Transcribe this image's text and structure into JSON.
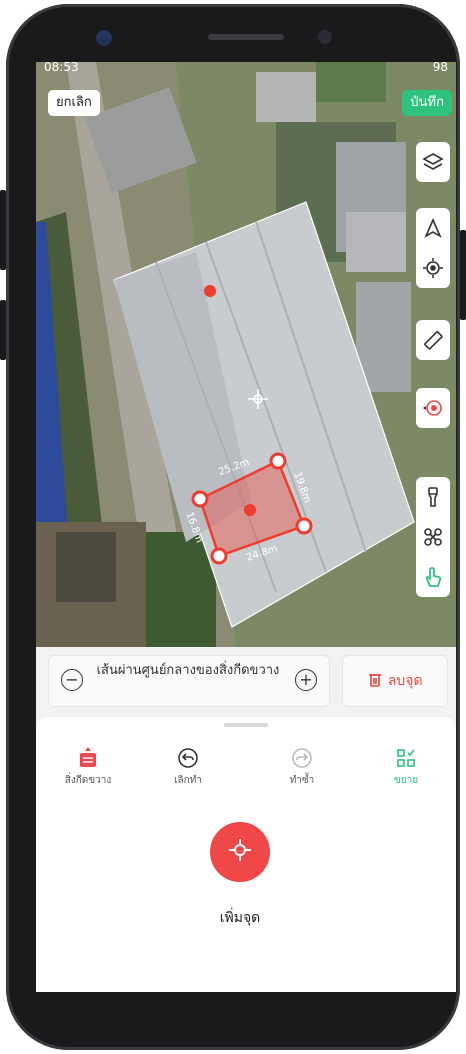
{
  "status": {
    "time": "08:53",
    "battery": "98"
  },
  "topbar": {
    "cancel_label": "ยกเลิก",
    "save_label": "บันทึก"
  },
  "map_tools": [
    "layers-icon",
    "navigation-icon",
    "locate-icon",
    "ruler-icon",
    "record-icon",
    "flashlight-icon",
    "drone-icon",
    "tap-icon"
  ],
  "measurements": {
    "top": "25.2m",
    "right": "19.8m",
    "left": "16.8m",
    "bottom": "24.8m"
  },
  "center_line": {
    "label": "เส้นผ่านศูนย์กลางของสิ่งกีดขวาง"
  },
  "delete_label": "ลบจุด",
  "actions": {
    "obstacle": "สิ่งกีดขวาง",
    "undo": "เลิกทำ",
    "redo": "ทำซ้ำ",
    "expand": "ขยาย"
  },
  "add_point_label": "เพิ่มจุด",
  "colors": {
    "accent_red": "#f04848",
    "accent_green": "#2ec27e"
  }
}
